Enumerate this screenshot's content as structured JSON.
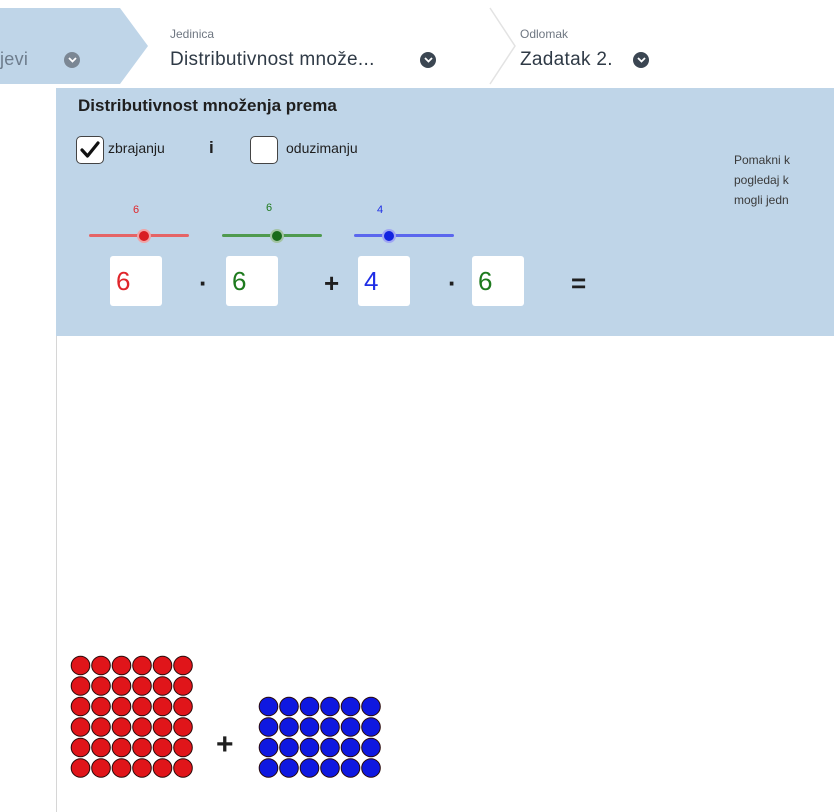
{
  "breadcrumb": {
    "prev_label": "jevi",
    "unit_caption": "Jedinica",
    "unit_value": "Distributivnost množe...",
    "section_caption": "Odlomak",
    "section_value": "Zadatak 2."
  },
  "panel": {
    "title": "Distributivnost množenja prema",
    "checkbox_add": {
      "label": "zbrajanju",
      "checked": true
    },
    "conjunction": "i",
    "checkbox_sub": {
      "label": "oduzimanju",
      "checked": false
    },
    "note_lines": [
      "Pomakni k",
      "pogledaj k",
      "mogli jedn"
    ],
    "sliders": [
      {
        "value": "6",
        "color": "#e0262b"
      },
      {
        "value": "6",
        "color": "#1e7a1e"
      },
      {
        "value": "4",
        "color": "#1f2ee6"
      }
    ],
    "expression": {
      "a": "6",
      "b": "6",
      "c": "4",
      "d": "6",
      "dot": "·",
      "plus": "+",
      "equals": "="
    }
  },
  "model": {
    "red_rows": 6,
    "red_cols": 6,
    "blue_rows": 4,
    "blue_cols": 6,
    "plus": "+",
    "colors": {
      "red": "#e0151a",
      "blue": "#0f18e0"
    }
  }
}
